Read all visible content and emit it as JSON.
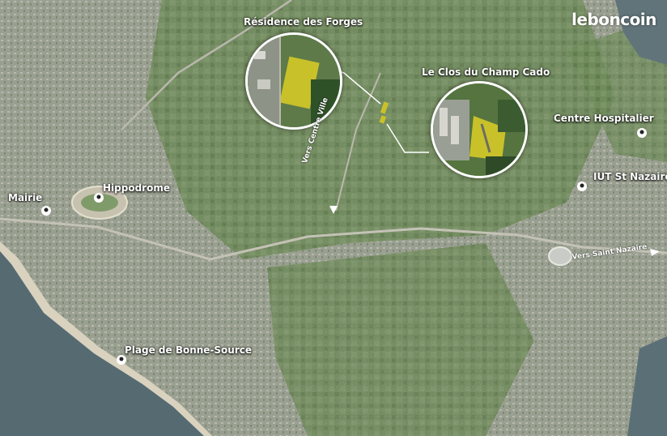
{
  "brand": {
    "logo_text": "leboncoin"
  },
  "places": [
    {
      "id": "mairie",
      "label": "Mairie"
    },
    {
      "id": "hippodrome",
      "label": "Hippodrome"
    },
    {
      "id": "plage",
      "label": "Plage de Bonne-Source"
    },
    {
      "id": "residence",
      "label": "Résidence des Forges"
    },
    {
      "id": "clos",
      "label": "Le Clos du Champ Cado"
    },
    {
      "id": "hospital",
      "label": "Centre Hospitalier"
    },
    {
      "id": "iut",
      "label": "IUT St Nazaire"
    }
  ],
  "roads": {
    "centre_ville": "Vers Centre Ville",
    "saint_nazaire": "Vers Saint Nazaire"
  },
  "colors": {
    "sea": "#566a72",
    "urban": "#9ea394",
    "fields": "#6f8a5b",
    "plot_highlight": "#c9c12a",
    "beach": "#d9d2bf",
    "label": "#ffffff"
  }
}
